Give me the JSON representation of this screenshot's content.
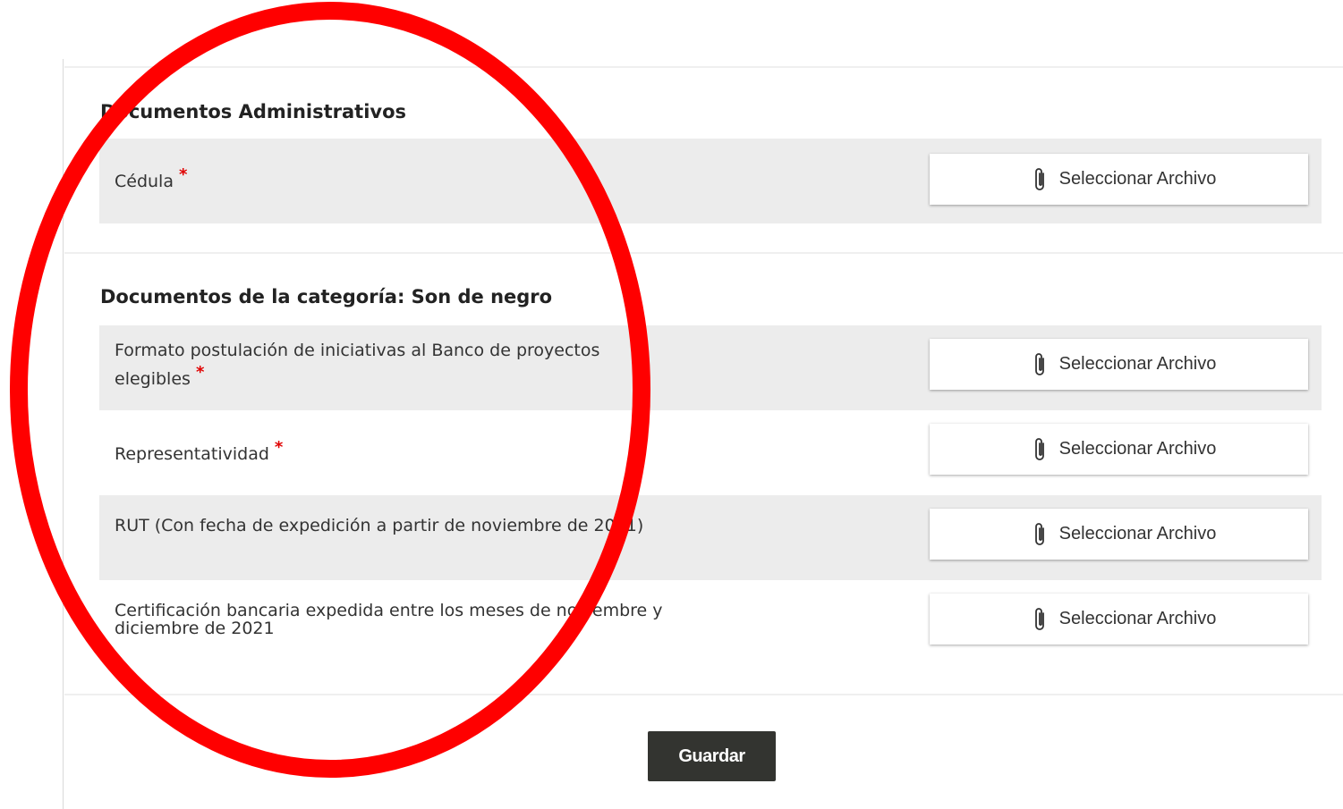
{
  "sections": [
    {
      "title": "Documentos Administrativos",
      "rows": [
        {
          "label": "Cédula",
          "required": "*",
          "button_label": "Seleccionar Archivo",
          "icon": "paperclip-icon"
        }
      ]
    },
    {
      "title": "Documentos de la categoría: Son de negro",
      "rows": [
        {
          "label": "Formato postulación de iniciativas al Banco de proyectos elegibles",
          "required": "*",
          "button_label": "Seleccionar Archivo",
          "icon": "paperclip-icon"
        },
        {
          "label": "Representatividad",
          "required": "*",
          "button_label": "Seleccionar Archivo",
          "icon": "paperclip-icon"
        },
        {
          "label": "RUT (Con fecha de expedición a partir de noviembre de 2021)",
          "button_label": "Seleccionar Archivo",
          "icon": "paperclip-icon"
        },
        {
          "label": "Certificación bancaria expedida entre los meses de noviembre y diciembre de 2021",
          "button_label": "Seleccionar Archivo",
          "icon": "paperclip-icon"
        }
      ]
    }
  ],
  "save_label": "Guardar",
  "colors": {
    "annotation": "#ff0000",
    "required": "#e00000",
    "save_button": "#333430",
    "row_shade": "#ececec"
  }
}
